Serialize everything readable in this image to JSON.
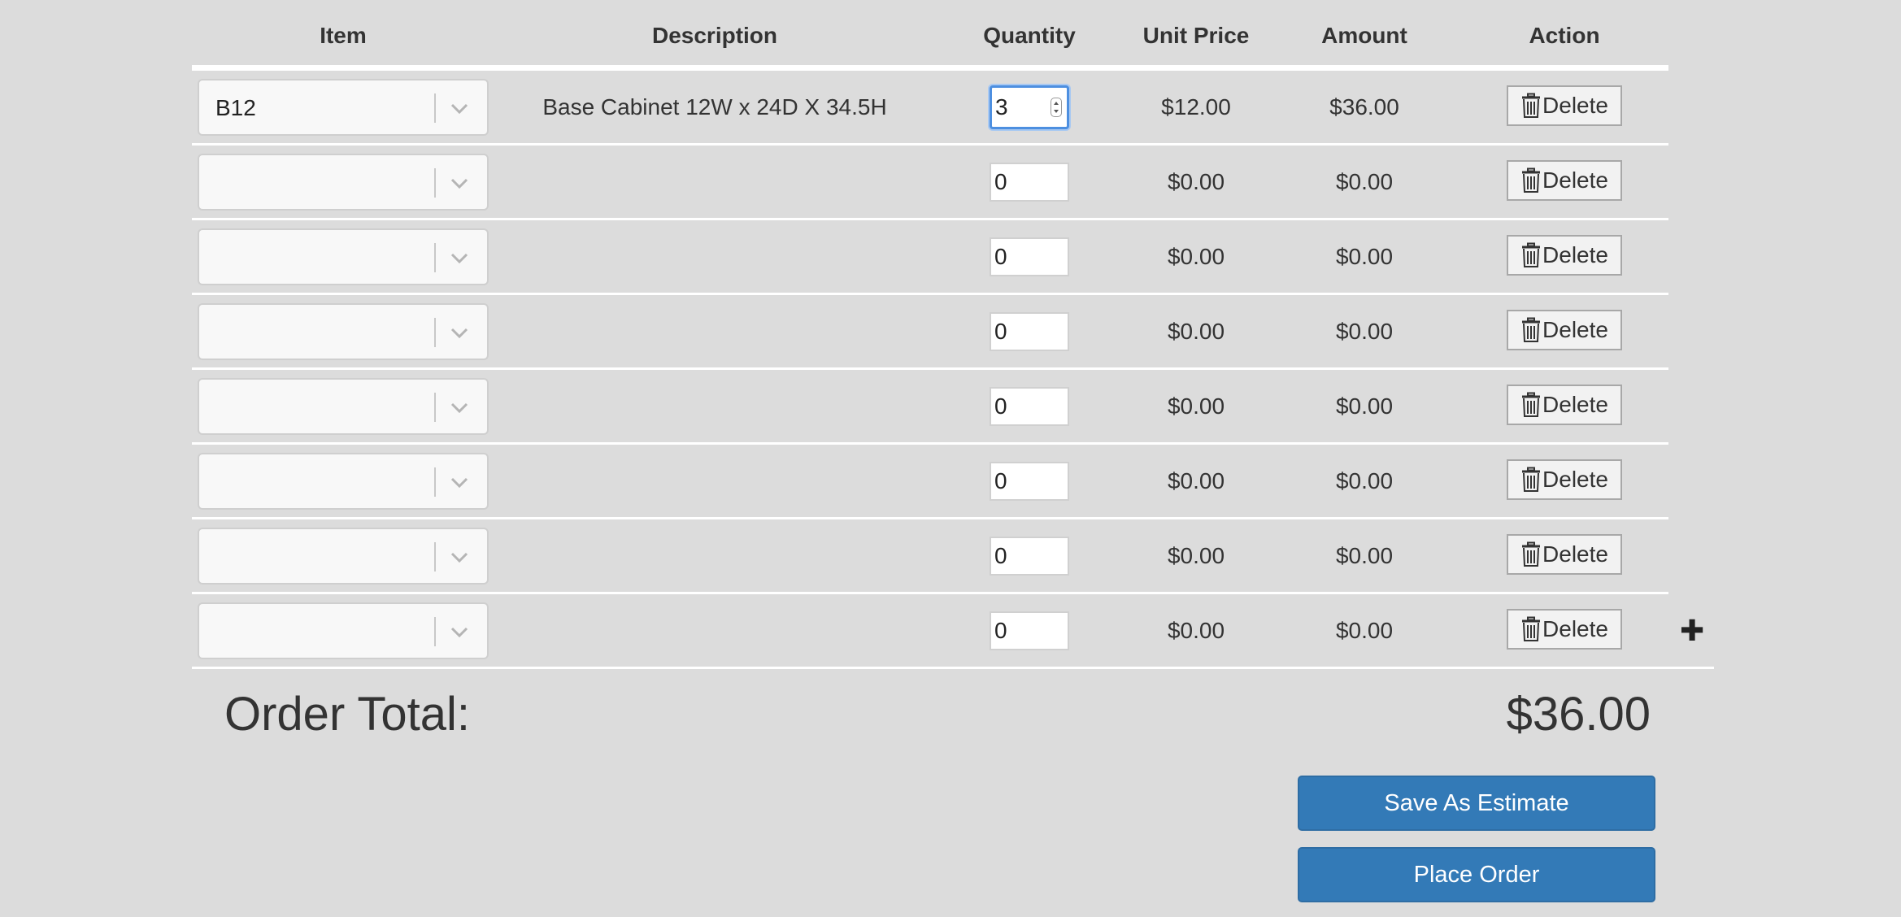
{
  "table": {
    "headers": {
      "item": "Item",
      "description": "Description",
      "quantity": "Quantity",
      "unit_price": "Unit Price",
      "amount": "Amount",
      "action": "Action"
    },
    "rows": [
      {
        "item": "B12",
        "description": "Base Cabinet 12W x 24D X 34.5H",
        "quantity": "3",
        "unit_price": "$12.00",
        "amount": "$36.00",
        "action_label": "Delete"
      },
      {
        "item": "",
        "description": "",
        "quantity": "0",
        "unit_price": "$0.00",
        "amount": "$0.00",
        "action_label": "Delete"
      },
      {
        "item": "",
        "description": "",
        "quantity": "0",
        "unit_price": "$0.00",
        "amount": "$0.00",
        "action_label": "Delete"
      },
      {
        "item": "",
        "description": "",
        "quantity": "0",
        "unit_price": "$0.00",
        "amount": "$0.00",
        "action_label": "Delete"
      },
      {
        "item": "",
        "description": "",
        "quantity": "0",
        "unit_price": "$0.00",
        "amount": "$0.00",
        "action_label": "Delete"
      },
      {
        "item": "",
        "description": "",
        "quantity": "0",
        "unit_price": "$0.00",
        "amount": "$0.00",
        "action_label": "Delete"
      },
      {
        "item": "",
        "description": "",
        "quantity": "0",
        "unit_price": "$0.00",
        "amount": "$0.00",
        "action_label": "Delete"
      },
      {
        "item": "",
        "description": "",
        "quantity": "0",
        "unit_price": "$0.00",
        "amount": "$0.00",
        "action_label": "Delete"
      }
    ],
    "add_row_icon": "plus-icon",
    "delete_icon": "trash-icon",
    "dropdown_icon": "chevron-down-icon"
  },
  "order": {
    "total_label": "Order Total:",
    "total_value": "$36.00"
  },
  "buttons": {
    "save_estimate": "Save As Estimate",
    "place_order": "Place Order"
  },
  "colors": {
    "background": "#dcdcdc",
    "primary_button": "#337ab7",
    "focus_ring": "#4d8fe0"
  }
}
